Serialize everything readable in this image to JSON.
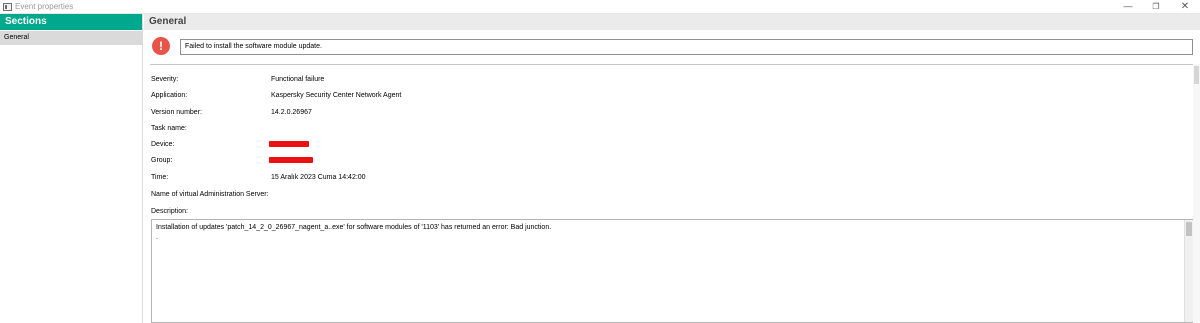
{
  "window": {
    "title": "Event properties",
    "controls": {
      "minimize": "—",
      "maximize": "❐",
      "close": "✕"
    }
  },
  "sidebar": {
    "header": "Sections",
    "items": [
      {
        "label": "General",
        "selected": true
      }
    ]
  },
  "main": {
    "header": "General",
    "message": "Failed to install the software module update.",
    "fields": [
      {
        "label": "Severity:",
        "value": "Functional failure"
      },
      {
        "label": "Application:",
        "value": "Kaspersky Security Center Network Agent"
      },
      {
        "label": "Version number:",
        "value": "14.2.0.26967"
      },
      {
        "label": "Task name:",
        "value": ""
      },
      {
        "label": "Device:",
        "value": "",
        "redacted": true
      },
      {
        "label": "Group:",
        "value": "",
        "redacted": true
      },
      {
        "label": "Time:",
        "value": "15 Aralık 2023 Cuma 14:42:00"
      },
      {
        "label": "Name of virtual Administration Server:",
        "value": ""
      }
    ],
    "description_label": "Description:",
    "description_line1": "Installation of updates 'patch_14_2_0_26967_nagent_a..exe' for software modules of '1103' has returned an error: Bad junction.",
    "description_line2": "."
  },
  "colors": {
    "accent": "#00a88e",
    "error": "#e8544a",
    "redaction": "#ee1111"
  },
  "icons": {
    "error": "exclamation-icon",
    "app": "window-icon"
  }
}
